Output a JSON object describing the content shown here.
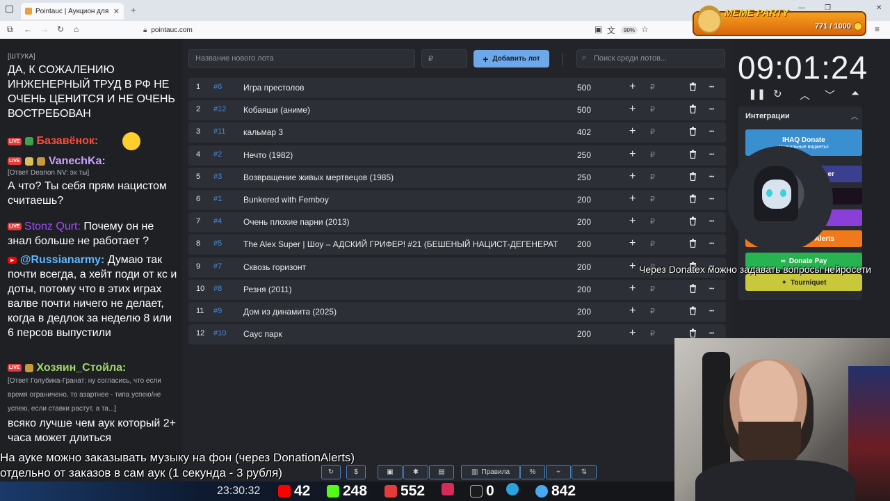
{
  "browser": {
    "tab_title": "Pointauc | Аукцион для стрим",
    "tab_close": "✕",
    "new_tab": "+",
    "url": "pointauc.com",
    "zoom": "90%",
    "window_controls": [
      "—",
      "❐",
      "✕"
    ]
  },
  "overlay_meme": {
    "title": "MEME PARTY",
    "count": "771 / 1000"
  },
  "chat": {
    "messages": [
      {
        "meta": "[ШТУКА]",
        "text": "ДА, К СОЖАЛЕНИЮ ИНЖЕНЕРНЫЙ ТРУД В РФ НЕ ОЧЕНЬ ЦЕНИТСЯ И НЕ ОЧЕНЬ ВОСТРЕБОВАН"
      },
      {
        "badge": "LIVE",
        "name": "Базавёнок:",
        "color": "#ff4b3a"
      },
      {
        "badge": "LIVE",
        "name": "VanechKa:",
        "color": "#c9a3ff",
        "meta": "[Ответ Deanon NV: эх ты]",
        "text": "А что? Ты себя прям нацистом считаешь?"
      },
      {
        "badge": "LIVE",
        "name": "Stonz Qurt:",
        "color": "#a04bff",
        "text": "Почему он не знал больше не работает ?"
      },
      {
        "badge": "YT",
        "name": "@Russianarmy:",
        "color": "#5fb8ff",
        "text": "Думаю так почти всегда, а хейт поди от кс и доты, потому что в этих играх валве почти ничего не делает, когда в дедлок за неделю 8 или 6 персов выпустили"
      },
      {
        "badge": "LIVE",
        "name": "Хозяин_Стойла:",
        "color": "#9fd66a",
        "meta": "[Ответ Голубика-Гранат: ну согласись, что если время ограничено, то азартнее - типа успею/не успею, если ставки растут, а та...]",
        "text": "всяко лучше чем аук который 2+ часа может длиться"
      }
    ]
  },
  "auction": {
    "new_lot_placeholder": "Название нового лота",
    "amount_placeholder": "₽",
    "add_button": "Добавить лот",
    "search_placeholder": "Поиск среди лотов...",
    "currency": "₽",
    "lots": [
      {
        "pos": "1",
        "id": "#6",
        "name": "Игра престолов",
        "amount": "500"
      },
      {
        "pos": "2",
        "id": "#12",
        "name": "Кобаяши (аниме)",
        "amount": "500"
      },
      {
        "pos": "3",
        "id": "#11",
        "name": "кальмар 3",
        "amount": "402"
      },
      {
        "pos": "4",
        "id": "#2",
        "name": "Нечто (1982)",
        "amount": "250"
      },
      {
        "pos": "5",
        "id": "#3",
        "name": "Возвращение живых мертвецов (1985)",
        "amount": "250"
      },
      {
        "pos": "6",
        "id": "#1",
        "name": "Bunkered with Femboy",
        "amount": "200"
      },
      {
        "pos": "7",
        "id": "#4",
        "name": "Очень плохие парни (2013)",
        "amount": "200"
      },
      {
        "pos": "8",
        "id": "#5",
        "name": "The Alex Super | Шоу – АДСКИЙ ГРИФЕР! #21 (БЕШЕНЫЙ НАЦИСТ-ДЕГЕНЕРАТ",
        "amount": "200"
      },
      {
        "pos": "9",
        "id": "#7",
        "name": "Сквозь горизонт",
        "amount": "200"
      },
      {
        "pos": "10",
        "id": "#8",
        "name": "Резня (2011)",
        "amount": "200"
      },
      {
        "pos": "11",
        "id": "#9",
        "name": "Дом из динамита (2025)",
        "amount": "200"
      },
      {
        "pos": "12",
        "id": "#10",
        "name": "Саус парк",
        "amount": "200"
      }
    ]
  },
  "timer": {
    "time": "09:01:24"
  },
  "integrations": {
    "title": "Интеграции",
    "buttons": [
      {
        "label": "IHAQ Donate",
        "sub": "Уникальные виджеты!",
        "color": "#3a8fd0"
      },
      {
        "label": "er",
        "color": "#3b3f8f"
      },
      {
        "label": "",
        "color": "#1a1020"
      },
      {
        "label": "",
        "color": "#8a3fd8"
      },
      {
        "label": "Alerts",
        "color": "#f07a1a"
      },
      {
        "label": "Donate Pay",
        "color": "#27b34f"
      },
      {
        "label": "Tourniquet",
        "color": "#c9c83a"
      }
    ]
  },
  "overlay_texts": {
    "donatex": "Через Donatex можно задавать вопросы нейросети",
    "music_line1": "На ауке можно заказывать музыку на фон (через DonationAlerts)",
    "music_line2": "отдельно от заказов в сам аук (1 секунда - 3 рубля)"
  },
  "bottom_toolbar": {
    "dollar": "$",
    "rules": "Правила",
    "percent": "%"
  },
  "statusbar": {
    "time": "23:30:32",
    "youtube": "42",
    "kick": "248",
    "live": "552",
    "rumble": "0",
    "viewers": "842"
  }
}
